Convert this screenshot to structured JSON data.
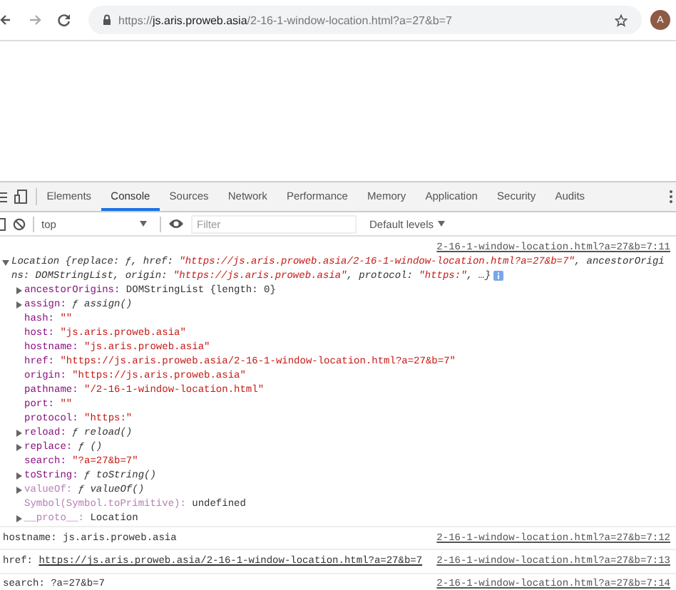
{
  "browser": {
    "url": {
      "scheme": "https://",
      "host": "js.aris.proweb.asia",
      "path": "/2-16-1-window-location.html?a=27&b=7"
    },
    "avatar": "A"
  },
  "devtools": {
    "tabs": [
      {
        "label": "Elements",
        "selected": false
      },
      {
        "label": "Console",
        "selected": true
      },
      {
        "label": "Sources",
        "selected": false
      },
      {
        "label": "Network",
        "selected": false
      },
      {
        "label": "Performance",
        "selected": false
      },
      {
        "label": "Memory",
        "selected": false
      },
      {
        "label": "Application",
        "selected": false
      },
      {
        "label": "Security",
        "selected": false
      },
      {
        "label": "Audits",
        "selected": false
      }
    ],
    "console_toolbar": {
      "context": "top",
      "filter": {
        "placeholder": "Filter"
      },
      "levels": "Default levels"
    },
    "entry": {
      "source": "2-16-1-window-location.html?a=27&b=7:11",
      "expanded": true,
      "summary": [
        {
          "kind": "plain",
          "text": "Location {replace: ƒ, href: "
        },
        {
          "kind": "string",
          "text": "\"https://js.aris.proweb.asia/2-16-1-window-location.html?a=27&b=7\""
        },
        {
          "kind": "plain",
          "text": ", ancestorOrigins: DOMStringList, origin: "
        },
        {
          "kind": "string",
          "text": "\"https://js.aris.proweb.asia\""
        },
        {
          "kind": "plain",
          "text": ", protocol: "
        },
        {
          "kind": "string",
          "text": "\"https:\""
        },
        {
          "kind": "plain",
          "text": ", …}"
        }
      ],
      "properties": [
        {
          "name": "ancestorOrigins:",
          "value": "DOMStringList {length: 0}",
          "kind": "object",
          "expandable": true,
          "dimmed": false
        },
        {
          "name": "assign:",
          "value": "ƒ assign()",
          "kind": "function",
          "expandable": true,
          "dimmed": false
        },
        {
          "name": "hash:",
          "value": "\"\"",
          "kind": "string",
          "expandable": false,
          "dimmed": false
        },
        {
          "name": "host:",
          "value": "\"js.aris.proweb.asia\"",
          "kind": "string",
          "expandable": false,
          "dimmed": false
        },
        {
          "name": "hostname:",
          "value": "\"js.aris.proweb.asia\"",
          "kind": "string",
          "expandable": false,
          "dimmed": false
        },
        {
          "name": "href:",
          "value": "\"https://js.aris.proweb.asia/2-16-1-window-location.html?a=27&b=7\"",
          "kind": "string",
          "expandable": false,
          "dimmed": false
        },
        {
          "name": "origin:",
          "value": "\"https://js.aris.proweb.asia\"",
          "kind": "string",
          "expandable": false,
          "dimmed": false
        },
        {
          "name": "pathname:",
          "value": "\"/2-16-1-window-location.html\"",
          "kind": "string",
          "expandable": false,
          "dimmed": false
        },
        {
          "name": "port:",
          "value": "\"\"",
          "kind": "string",
          "expandable": false,
          "dimmed": false
        },
        {
          "name": "protocol:",
          "value": "\"https:\"",
          "kind": "string",
          "expandable": false,
          "dimmed": false
        },
        {
          "name": "reload:",
          "value": "ƒ reload()",
          "kind": "function",
          "expandable": true,
          "dimmed": false
        },
        {
          "name": "replace:",
          "value": "ƒ ()",
          "kind": "function",
          "expandable": true,
          "dimmed": false
        },
        {
          "name": "search:",
          "value": "\"?a=27&b=7\"",
          "kind": "string",
          "expandable": false,
          "dimmed": false
        },
        {
          "name": "toString:",
          "value": "ƒ toString()",
          "kind": "function",
          "expandable": true,
          "dimmed": false
        },
        {
          "name": "valueOf:",
          "value": "ƒ valueOf()",
          "kind": "function",
          "expandable": true,
          "dimmed": true
        },
        {
          "name": "Symbol(Symbol.toPrimitive):",
          "value": "undefined",
          "kind": "object",
          "expandable": false,
          "dimmed": true
        },
        {
          "name": "__proto__:",
          "value": "Location",
          "kind": "object",
          "expandable": true,
          "dimmed": true
        }
      ]
    },
    "logs": [
      {
        "label": "hostname: ",
        "value": "js.aris.proweb.asia",
        "kind": "text",
        "source": "2-16-1-window-location.html?a=27&b=7:12"
      },
      {
        "label": "href: ",
        "value": "https://js.aris.proweb.asia/2-16-1-window-location.html?a=27&b=7",
        "kind": "link",
        "source": "2-16-1-window-location.html?a=27&b=7:13"
      },
      {
        "label": "search: ",
        "value": "?a=27&b=7",
        "kind": "text",
        "source": "2-16-1-window-location.html?a=27&b=7:14"
      }
    ]
  }
}
